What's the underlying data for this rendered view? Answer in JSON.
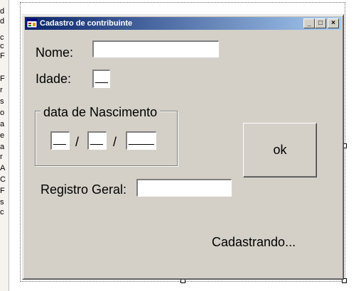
{
  "window": {
    "title": "Cadastro de contribuinte",
    "minimize_glyph": "_",
    "maximize_glyph": "□",
    "close_glyph": "×"
  },
  "form": {
    "nome_label": "Nome:",
    "nome_value": "",
    "idade_label": "Idade:",
    "idade_value": "__",
    "group_label": "data de Nascimento",
    "dia_value": "__",
    "mes_value": "__",
    "ano_value": "____",
    "separator": "/",
    "registro_label": "Registro Geral:",
    "registro_value": "",
    "ok_label": "ok",
    "status_text": "Cadastrando..."
  },
  "left_strip": [
    "d",
    "d",
    "c",
    "c",
    "F",
    "F",
    "r",
    "s",
    "o",
    "a",
    "e",
    "a",
    "r",
    "A",
    "C",
    "F",
    "s",
    "c"
  ],
  "colors": {
    "titlebar_start": "#0a246a",
    "titlebar_end": "#a6caf0",
    "form_background": "#d4d0c8"
  },
  "icons": {
    "window_icon": "form-icon"
  }
}
